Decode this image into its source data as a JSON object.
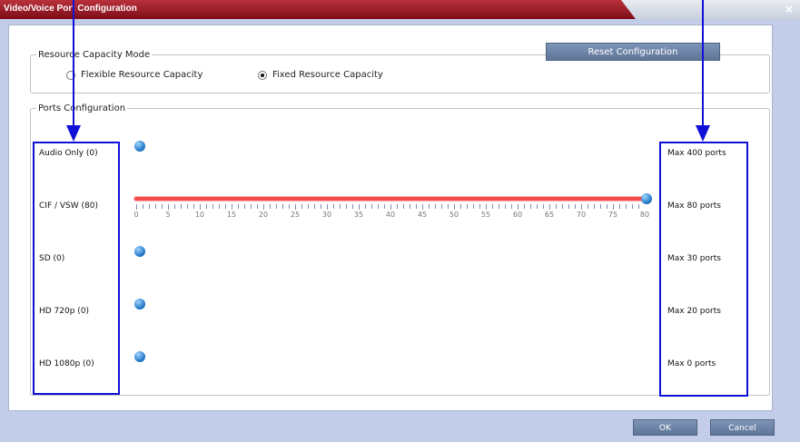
{
  "window": {
    "title": "Video/Voice Port Configuration",
    "close": "×"
  },
  "capacity_mode": {
    "legend": "Resource Capacity Mode",
    "options": [
      {
        "label": "Flexible Resource Capacity",
        "selected": false
      },
      {
        "label": "Fixed Resource Capacity",
        "selected": true
      }
    ],
    "reset_label": "Reset Configuration"
  },
  "ports": {
    "legend": "Ports Configuration",
    "rows": [
      {
        "label": "Audio Only (0)",
        "max": "Max 400 ports",
        "value": 0
      },
      {
        "label": "CIF / VSW (80)",
        "max": "Max 80 ports",
        "value": 80
      },
      {
        "label": "SD (0)",
        "max": "Max 30 ports",
        "value": 0
      },
      {
        "label": "HD 720p (0)",
        "max": "Max 20 ports",
        "value": 0
      },
      {
        "label": "HD 1080p (0)",
        "max": "Max 0 ports",
        "value": 0
      }
    ],
    "scale": [
      "0",
      "5",
      "10",
      "15",
      "20",
      "25",
      "30",
      "35",
      "40",
      "45",
      "50",
      "55",
      "60",
      "65",
      "70",
      "75",
      "80"
    ]
  },
  "footer": {
    "ok": "OK",
    "cancel": "Cancel"
  },
  "colors": {
    "title_bar": "#9b1c27",
    "highlight_box": "#1010d8",
    "slider_track": "#f24a4a",
    "button": "#6a82a6"
  }
}
